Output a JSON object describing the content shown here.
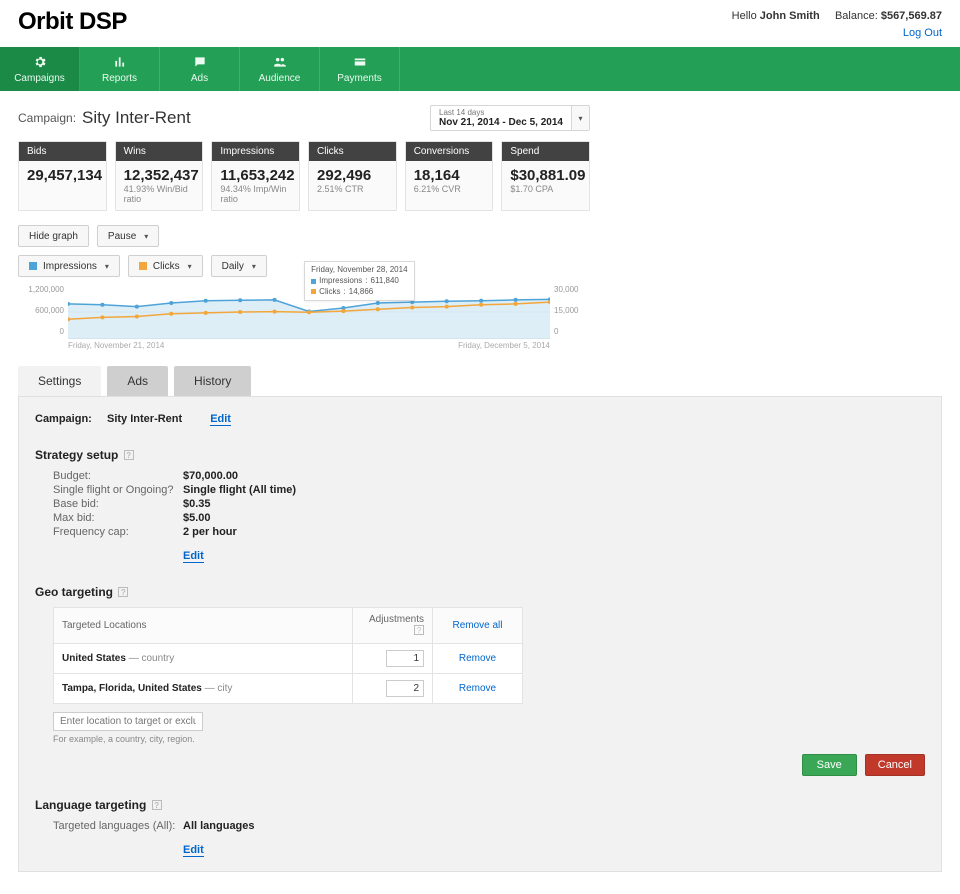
{
  "brand": "Orbit DSP",
  "header": {
    "hello": "Hello",
    "user": "John Smith",
    "balance_label": "Balance:",
    "balance": "$567,569.87",
    "logout": "Log Out"
  },
  "nav": {
    "campaigns": "Campaigns",
    "reports": "Reports",
    "ads": "Ads",
    "audience": "Audience",
    "payments": "Payments"
  },
  "campaign": {
    "label": "Campaign:",
    "name": "Sity Inter-Rent"
  },
  "date_picker": {
    "label": "Last 14 days",
    "range": "Nov 21, 2014 - Dec 5, 2014"
  },
  "metrics": [
    {
      "title": "Bids",
      "value": "29,457,134",
      "sub": ""
    },
    {
      "title": "Wins",
      "value": "12,352,437",
      "sub": "41.93%  Win/Bid ratio"
    },
    {
      "title": "Impressions",
      "value": "11,653,242",
      "sub": "94.34% Imp/Win ratio"
    },
    {
      "title": "Clicks",
      "value": "292,496",
      "sub": "2.51%  CTR"
    },
    {
      "title": "Conversions",
      "value": "18,164",
      "sub": "6.21%  CVR"
    },
    {
      "title": "Spend",
      "value": "$30,881.09",
      "sub": "$1.70  CPA"
    }
  ],
  "toolbar": {
    "hide_graph": "Hide graph",
    "pause": "Pause",
    "series_a": "Impressions",
    "series_b": "Clicks",
    "granularity": "Daily"
  },
  "chart_data": {
    "type": "line",
    "title": "",
    "x_start": "Friday, November 21, 2014",
    "x_end": "Friday, December 5, 2014",
    "left_axis": {
      "label": "",
      "ticks": [
        1200000,
        600000,
        0
      ]
    },
    "right_axis": {
      "label": "",
      "ticks": [
        30000,
        15000,
        0
      ]
    },
    "categories": [
      "2014-11-21",
      "2014-11-22",
      "2014-11-23",
      "2014-11-24",
      "2014-11-25",
      "2014-11-26",
      "2014-11-27",
      "2014-11-28",
      "2014-11-29",
      "2014-11-30",
      "2014-12-01",
      "2014-12-02",
      "2014-12-03",
      "2014-12-04",
      "2014-12-05"
    ],
    "series": [
      {
        "name": "Impressions",
        "axis": "left",
        "color": "#4ea3d8",
        "values": [
          780000,
          760000,
          720000,
          800000,
          850000,
          860000,
          870000,
          611840,
          690000,
          800000,
          820000,
          840000,
          850000,
          870000,
          880000
        ]
      },
      {
        "name": "Clicks",
        "axis": "right",
        "color": "#f2a63c",
        "values": [
          11000,
          12000,
          12500,
          14000,
          14500,
          15000,
          15200,
          14866,
          15500,
          16500,
          17500,
          18000,
          19000,
          19500,
          20500
        ]
      }
    ],
    "tooltip": {
      "title": "Friday, November 28, 2014",
      "rows": [
        {
          "series": "Impressions",
          "value": "611,840"
        },
        {
          "series": "Clicks",
          "value": "14,866"
        }
      ]
    }
  },
  "tabs": {
    "settings": "Settings",
    "ads": "Ads",
    "history": "History"
  },
  "settings": {
    "campaign_label": "Campaign:",
    "campaign_name": "Sity Inter-Rent",
    "edit": "Edit",
    "strategy_title": "Strategy setup",
    "strategy": {
      "budget_k": "Budget:",
      "budget_v": "$70,000.00",
      "flight_k": "Single flight or Ongoing?",
      "flight_v": "Single flight (All time)",
      "base_k": "Base bid:",
      "base_v": "$0.35",
      "max_k": "Max bid:",
      "max_v": "$5.00",
      "freq_k": "Frequency cap:",
      "freq_v": "2 per hour"
    },
    "geo_title": "Geo targeting",
    "geo_table": {
      "col_loc": "Targeted Locations",
      "col_adj": "Adjustments",
      "remove_all": "Remove all",
      "rows": [
        {
          "main": "United States",
          "type": "country",
          "adj": "1",
          "action": "Remove"
        },
        {
          "main": "Tampa, Florida, United States",
          "type": "city",
          "adj": "2",
          "action": "Remove"
        }
      ]
    },
    "geo_placeholder": "Enter location to target or exclude.",
    "geo_hint": "For example, a country, city, region.",
    "save": "Save",
    "cancel": "Cancel",
    "lang_title": "Language targeting",
    "lang_k": "Targeted languages (All):",
    "lang_v": "All languages"
  }
}
